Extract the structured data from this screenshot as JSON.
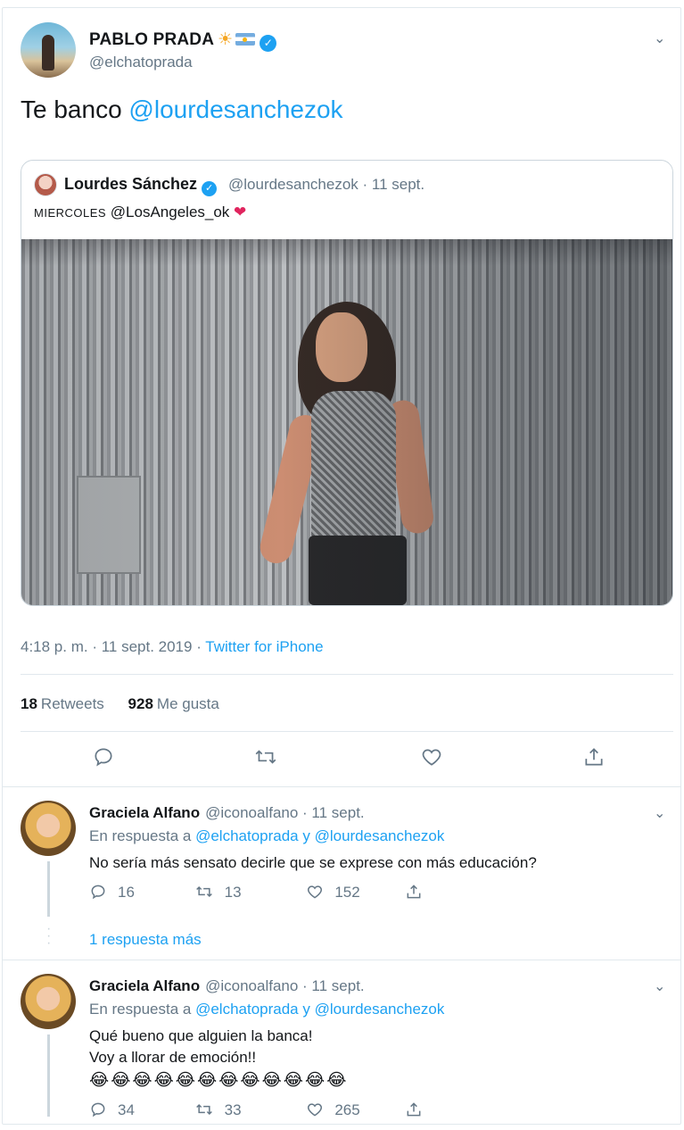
{
  "tweet": {
    "author_name": "PABLO PRADA",
    "author_handle": "@elchatoprada",
    "text_prefix": "Te banco ",
    "text_mention": "@lourdesanchezok",
    "timestamp": "4:18 p. m. · 11 sept. 2019 · ",
    "via": "Twitter for iPhone",
    "retweets_count": "18",
    "retweets_label": "Retweets",
    "likes_count": "928",
    "likes_label": "Me gusta",
    "icons": [
      "reply-icon",
      "retweet-icon",
      "like-icon",
      "share-icon"
    ]
  },
  "quoted": {
    "author_name": "Lourdes Sánchez",
    "meta": "@lourdesanchezok · 11 sept.",
    "text_small": "MIERCOLES",
    "text_mention": " @LosAngeles_ok "
  },
  "replies": [
    {
      "author_name": "Graciela Alfano",
      "author_handle": "@iconoalfano · 11 sept.",
      "reply_prefix": "En respuesta a ",
      "reply_to": "@elchatoprada y @lourdesanchezok",
      "text_lines": [
        "No sería más sensato decirle que se  exprese con más educación?"
      ],
      "replies": "16",
      "retweets": "13",
      "likes": "152",
      "more_replies": "1 respuesta más"
    },
    {
      "author_name": "Graciela Alfano",
      "author_handle": "@iconoalfano · 11 sept.",
      "reply_prefix": "En respuesta a ",
      "reply_to": "@elchatoprada y @lourdesanchezok",
      "text_lines": [
        "Qué bueno que alguien la banca!",
        "Voy a llorar de emoción!!"
      ],
      "emojis": "😂😂😂😂😂😂😂😂😂😂😂😂",
      "replies": "34",
      "retweets": "33",
      "likes": "265"
    }
  ],
  "colors": {
    "accent": "#1da1f2",
    "muted": "#657786",
    "heart": "#e0245e"
  }
}
